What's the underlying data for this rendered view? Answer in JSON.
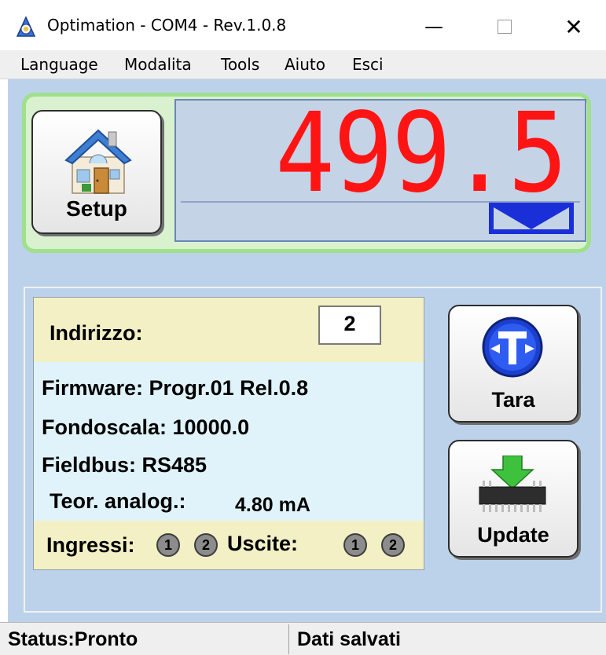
{
  "window": {
    "title": "Optimation - COM4 - Rev.1.0.8",
    "icons": {
      "app": "app-icon",
      "minimize": "minimize-icon",
      "maximize": "maximize-icon",
      "close": "close-icon"
    },
    "minimize_glyph": "—",
    "close_glyph": "✕"
  },
  "menu": {
    "items": [
      "Language",
      "Modalita",
      "Tools",
      "Aiuto",
      "Esci"
    ]
  },
  "setup_button": {
    "label": "Setup",
    "icon": "house-icon"
  },
  "display": {
    "value": "499.5",
    "value_color": "#ff1414",
    "indicator_icon": "envelope-icon",
    "indicator_color": "#1a2fd8"
  },
  "info": {
    "address_label": "Indirizzo:",
    "address_value": "2",
    "firmware": "Firmware: Progr.01 Rel.0.8",
    "fondoscala": "Fondoscala: 10000.0",
    "fieldbus": "Fieldbus: RS485",
    "analog_label": "Teor. analog.:",
    "analog_value": "4.80 mA",
    "inputs_label": "Ingressi:",
    "inputs": [
      "1",
      "2"
    ],
    "outputs_label": "Uscite:",
    "outputs": [
      "1",
      "2"
    ]
  },
  "tara_button": {
    "label": "Tara",
    "icon": "tare-icon"
  },
  "update_button": {
    "label": "Update",
    "icon": "chip-download-icon"
  },
  "status": {
    "left": "Status:Pronto",
    "right": "Dati salvati"
  },
  "colors": {
    "client_bg": "#bcd2ea",
    "display_frame": "#9fe08a",
    "card_yellow": "#f2f0c4",
    "card_blue": "#e0f3fb"
  }
}
